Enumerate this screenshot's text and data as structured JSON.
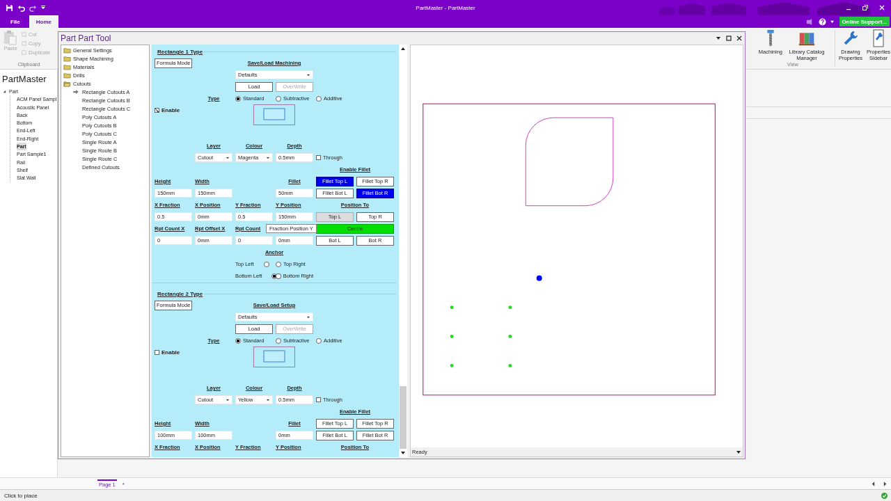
{
  "window": {
    "title": "PartMaster - PartMaster"
  },
  "ribbon_tabs": [
    {
      "label": "File",
      "selected": false
    },
    {
      "label": "Home",
      "selected": true
    }
  ],
  "online_support": "Online Support...",
  "clipboard": {
    "label": "Clipboard",
    "paste": {
      "label": "Paste",
      "disabled": true
    },
    "small": [
      {
        "label": "Cut",
        "disabled": true
      },
      {
        "label": "Copy",
        "disabled": true
      },
      {
        "label": "Duplicate",
        "disabled": true
      }
    ]
  },
  "view_group": {
    "label": "View",
    "buttons": [
      "Machining",
      "Library Catalog Manager"
    ]
  },
  "properties_buttons": [
    "Drawing Properties",
    "Properties Sidebar"
  ],
  "explorer": {
    "title": "PartMaster",
    "tree": [
      {
        "label": "Part",
        "expanded": true,
        "children": [
          {
            "label": "ACM Panel Sampl",
            "selected": false
          },
          {
            "label": "Acoustic Panel",
            "selected": false
          },
          {
            "label": "Back",
            "selected": false
          },
          {
            "label": "Bottom",
            "selected": false
          },
          {
            "label": "End-Left",
            "selected": false
          },
          {
            "label": "End-Right",
            "selected": false
          },
          {
            "label": "Part",
            "selected": true
          },
          {
            "label": "Part Sample1",
            "selected": false
          },
          {
            "label": "Rail",
            "selected": false
          },
          {
            "label": "Shelf",
            "selected": false
          },
          {
            "label": "Slat Wall",
            "selected": false
          }
        ]
      }
    ]
  },
  "part_tool": {
    "title": "Part Part Tool",
    "nav_tree": [
      {
        "label": "General Settings",
        "expanded": false
      },
      {
        "label": "Shape Machining",
        "expanded": false
      },
      {
        "label": "Materials",
        "expanded": false
      },
      {
        "label": "Drills",
        "expanded": false
      },
      {
        "label": "Cutouts",
        "expanded": true,
        "children": [
          {
            "label": "Rectangle Cutouts A",
            "current": true
          },
          {
            "label": "Rectangle Cutouts B",
            "current": false
          },
          {
            "label": "Rectangle Cutouts C",
            "current": false
          },
          {
            "label": "Poly Cutouts A",
            "current": false
          },
          {
            "label": "Poly Cutouts B",
            "current": false
          },
          {
            "label": "Poly Cutouts C",
            "current": false
          },
          {
            "label": "Single Route A",
            "current": false
          },
          {
            "label": "Single Route B",
            "current": false
          },
          {
            "label": "Single Route C",
            "current": false
          },
          {
            "label": "Defined Cutouts",
            "current": false
          }
        ]
      }
    ],
    "sections": [
      {
        "title": "Rectangle 1 Type",
        "formula_button": "Formula Mode",
        "save_load_title": "Save/Load Machining",
        "preset": "Defaults",
        "load_button": "Load",
        "overwrite_button": {
          "label": "OverWrite",
          "disabled": true
        },
        "type_label": "Type",
        "type_options": [
          {
            "label": "Standard",
            "selected": true
          },
          {
            "label": "Subtractive",
            "selected": false
          },
          {
            "label": "Additive",
            "selected": false
          }
        ],
        "enable": {
          "label": "Enable",
          "checked": true
        },
        "settings": [
          {
            "label": "Layer",
            "value": "Cutout",
            "kind": "dropdown"
          },
          {
            "label": "Colour",
            "value": "Magenta",
            "kind": "dropdown"
          },
          {
            "label": "Depth",
            "value": "0.5mm",
            "kind": "input"
          }
        ],
        "through": {
          "label": "Through",
          "checked": false
        },
        "enable_fillet_label": "Enable Fillet",
        "size_fields": [
          {
            "label": "Height",
            "value": "150mm"
          },
          {
            "label": "Width",
            "value": "150mm"
          },
          {
            "label": "Fillet",
            "value": "50mm"
          }
        ],
        "fillet_buttons": [
          {
            "label": "Fillet Top L",
            "selected": true
          },
          {
            "label": "Fillet Top R",
            "selected": false
          },
          {
            "label": "Fillet Bot L",
            "selected": false
          },
          {
            "label": "Fillet Bot R",
            "selected": true
          }
        ],
        "position_fields": [
          {
            "label": "X Fraction",
            "value": "0.5"
          },
          {
            "label": "X Position",
            "value": "0mm"
          },
          {
            "label": "Y Fraction",
            "value": "0.5"
          },
          {
            "label": "Y Position",
            "value": "150mm"
          }
        ],
        "position_to_label": "Position To",
        "position_buttons": [
          {
            "label": "Top L",
            "selected": false,
            "hovered": true
          },
          {
            "label": "Top R",
            "selected": false,
            "hovered": false
          },
          {
            "label": "Centre",
            "selected": true,
            "hovered": false
          },
          {
            "label": "Bot L",
            "selected": false,
            "hovered": false
          },
          {
            "label": "Bot R",
            "selected": false,
            "hovered": false
          }
        ],
        "repeat_fields": [
          {
            "label": "Rpt Count X",
            "value": "0"
          },
          {
            "label": "Rpt Offset X",
            "value": "0mm"
          },
          {
            "label": "Rpt Count",
            "value": "0"
          },
          {
            "value": "0mm"
          }
        ],
        "tooltip": "Fraction Position Y",
        "anchor_label": "Anchor",
        "anchor_options": [
          {
            "label": "Top Left",
            "selected": false
          },
          {
            "label": "Top Right",
            "selected": false
          },
          {
            "label": "Bottom Left",
            "selected": true
          },
          {
            "label": "Bottom Right",
            "selected": false
          }
        ]
      },
      {
        "title": "Rectangle 2 Type",
        "formula_button": "Formula Mode",
        "save_load_title": "Save/Load Setup",
        "preset": "Defaults",
        "load_button": "Load",
        "overwrite_button": {
          "label": "OverWrite",
          "disabled": true
        },
        "type_label": "Type",
        "type_options": [
          {
            "label": "Standard",
            "selected": true
          },
          {
            "label": "Subtractive",
            "selected": false
          },
          {
            "label": "Additive",
            "selected": false
          }
        ],
        "enable": {
          "label": "Enable",
          "checked": false
        },
        "settings": [
          {
            "label": "Layer",
            "value": "Cutout",
            "kind": "dropdown"
          },
          {
            "label": "Colour",
            "value": "Yellow",
            "kind": "dropdown"
          },
          {
            "label": "Depth",
            "value": "0.5mm",
            "kind": "input"
          }
        ],
        "through": {
          "label": "Through",
          "checked": false
        },
        "enable_fillet_label": "Enable Fillet",
        "size_fields": [
          {
            "label": "Height",
            "value": "100mm"
          },
          {
            "label": "Width",
            "value": "100mm"
          },
          {
            "label": "Fillet",
            "value": "0mm"
          }
        ],
        "fillet_buttons": [
          {
            "label": "Fillet Top L",
            "selected": false
          },
          {
            "label": "Fillet Top R",
            "selected": false
          },
          {
            "label": "Fillet Bot L",
            "selected": false
          },
          {
            "label": "Fillet Bot R",
            "selected": false
          }
        ],
        "position_fields": [
          {
            "label": "X Fraction"
          },
          {
            "label": "X Position"
          },
          {
            "label": "Y Fraction"
          },
          {
            "label": "Y Position"
          }
        ],
        "position_to_label": "Position To"
      }
    ],
    "canvas_status": "Ready"
  },
  "page_tabs": [
    {
      "label": "Page 1",
      "selected": true
    },
    {
      "label": "*",
      "selected": false
    }
  ],
  "status_bar": "Click to place"
}
